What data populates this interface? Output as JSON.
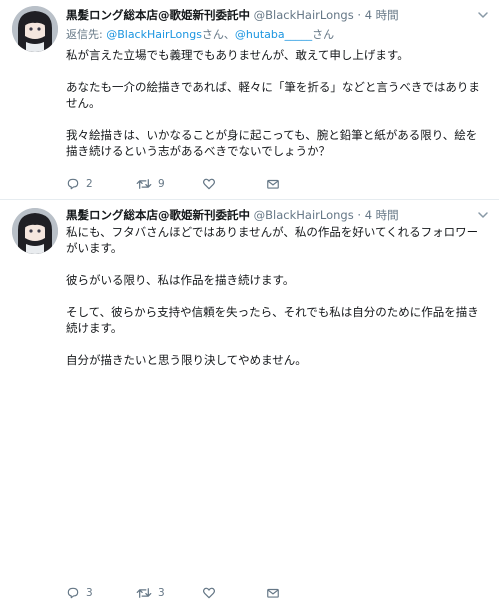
{
  "tweets": [
    {
      "author_name": "黒髪ロング総本店@歌姫新刊委託中",
      "handle": "@BlackHairLongs",
      "separator": "·",
      "time": "4 時間",
      "reply_prefix": "返信先:",
      "reply_user_1": "@BlackHairLongs",
      "reply_suffix_1": "さん、",
      "reply_user_2": "@hutaba_____",
      "reply_suffix_2": "さん",
      "paragraphs": [
        "私が言えた立場でも義理でもありませんが、敢えて申し上げます。",
        "あなたも一介の絵描きであれば、軽々に「筆を折る」などと言うべきではありません。",
        "我々絵描きは、いかなることが身に起こっても、腕と鉛筆と紙がある限り、絵を描き続けるという志があるべきでないでしょうか？"
      ],
      "reply_count": "2",
      "retweet_count": "9",
      "like_count": ""
    },
    {
      "author_name": "黒髪ロング総本店@歌姫新刊委託中",
      "handle": "@BlackHairLongs",
      "separator": "·",
      "time": "4 時間",
      "paragraphs": [
        "私にも、フタバさんほどではありませんが、私の作品を好いてくれるフォロワーがいます。",
        "彼らがいる限り、私は作品を描き続けます。",
        "そして、彼らから支持や信頼を失ったら、それでも私は自分のために作品を描き続けます。",
        "自分が描きたいと思う限り決してやめません。"
      ],
      "reply_count": "3",
      "retweet_count": "3",
      "like_count": ""
    }
  ],
  "icons": {
    "reply": "reply-icon",
    "retweet": "retweet-icon",
    "like": "heart-icon",
    "dm": "envelope-icon",
    "menu": "chevron-down-icon"
  },
  "colors": {
    "text": "#14171a",
    "muted": "#657786",
    "link": "#1b95e0",
    "divider": "#e6ecf0"
  }
}
